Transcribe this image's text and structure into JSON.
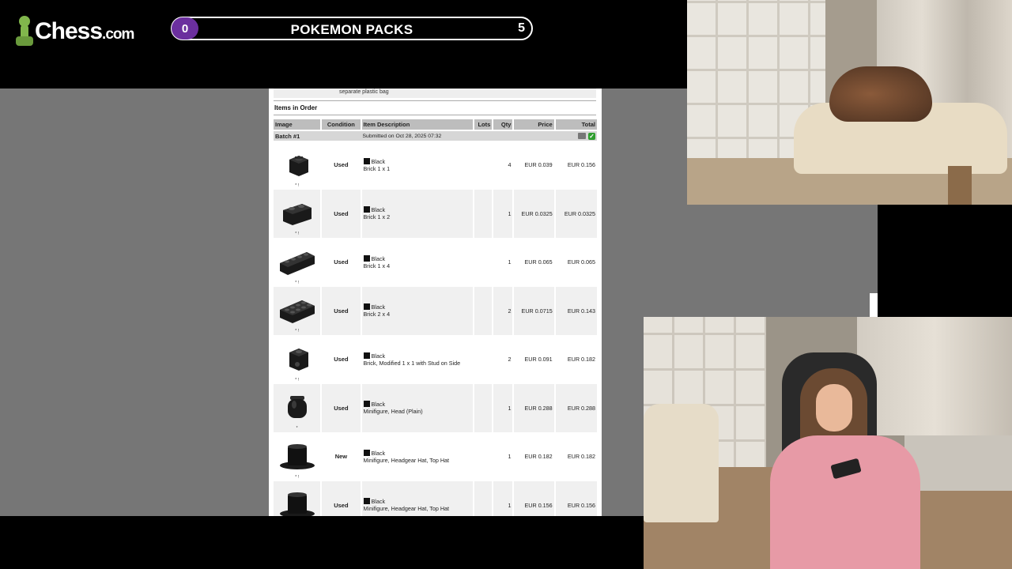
{
  "overlay": {
    "logo_text": "Chess",
    "logo_suffix": ".com",
    "score_left": "0",
    "title": "POKEMON PACKS",
    "score_right": "5"
  },
  "document": {
    "top_note": "separate plastic bag",
    "section_title": "Items in Order",
    "columns": [
      "Image",
      "Condition",
      "Item Description",
      "Lots",
      "Qty",
      "Price",
      "Total"
    ],
    "batch_label": "Batch #1",
    "batch_submitted": "Submitted on Oct 28, 2025 07:32",
    "items": [
      {
        "mark": "* !",
        "condition": "Used",
        "color": "Black",
        "name": "Brick 1 x 1",
        "qty": "4",
        "price": "EUR 0.039",
        "total": "EUR 0.156"
      },
      {
        "mark": "* !",
        "condition": "Used",
        "color": "Black",
        "name": "Brick 1 x 2",
        "qty": "1",
        "price": "EUR 0.0325",
        "total": "EUR 0.0325"
      },
      {
        "mark": "* !",
        "condition": "Used",
        "color": "Black",
        "name": "Brick 1 x 4",
        "qty": "1",
        "price": "EUR 0.065",
        "total": "EUR 0.065"
      },
      {
        "mark": "* !",
        "condition": "Used",
        "color": "Black",
        "name": "Brick 2 x 4",
        "qty": "2",
        "price": "EUR 0.0715",
        "total": "EUR 0.143"
      },
      {
        "mark": "* !",
        "condition": "Used",
        "color": "Black",
        "name": "Brick, Modified 1 x 1 with Stud on Side",
        "qty": "2",
        "price": "EUR 0.091",
        "total": "EUR 0.182"
      },
      {
        "mark": "*",
        "condition": "Used",
        "color": "Black",
        "name": "Minifigure, Head (Plain)",
        "qty": "1",
        "price": "EUR 0.288",
        "total": "EUR 0.288"
      },
      {
        "mark": "* !",
        "condition": "New",
        "color": "Black",
        "name": "Minifigure, Headgear Hat, Top Hat",
        "qty": "1",
        "price": "EUR 0.182",
        "total": "EUR 0.182"
      },
      {
        "mark": "",
        "condition": "Used",
        "color": "Black",
        "name": "Minifigure, Headgear Hat, Top Hat",
        "qty": "1",
        "price": "EUR 0.156",
        "total": "EUR 0.156"
      }
    ],
    "piece_icons": [
      "brick-1x1-icon",
      "brick-1x2-icon",
      "brick-1x4-icon",
      "brick-2x4-icon",
      "brick-modified-1x1-icon",
      "minifig-head-icon",
      "top-hat-icon",
      "top-hat-icon"
    ]
  },
  "colors": {
    "accent_purple": "#6b2f9e",
    "chess_green": "#81b64c",
    "screen_gray": "#767676"
  }
}
